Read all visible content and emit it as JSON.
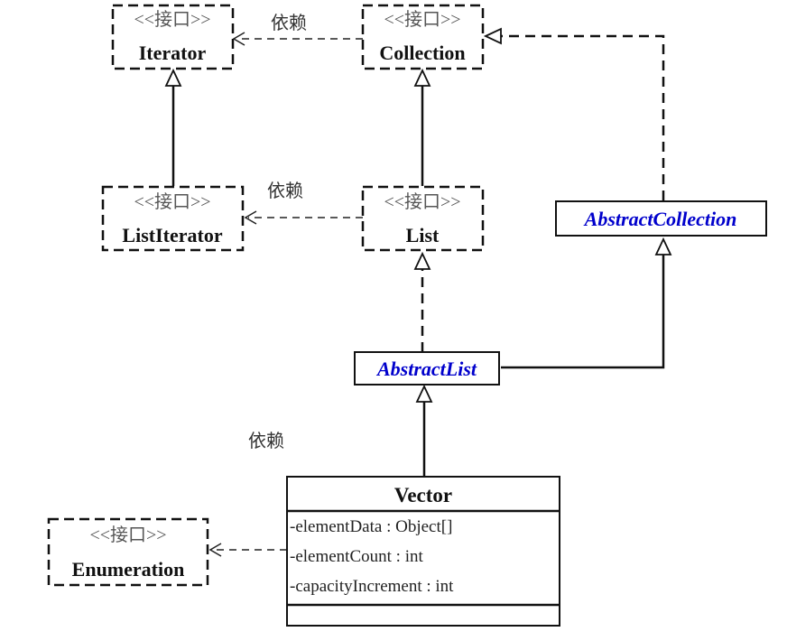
{
  "stereotype": "<<接口>>",
  "dependency_label": "依赖",
  "interfaces": {
    "iterator": "Iterator",
    "collection": "Collection",
    "list_iterator": "ListIterator",
    "list": "List",
    "enumeration": "Enumeration"
  },
  "abstract_classes": {
    "abstract_collection": "AbstractCollection",
    "abstract_list": "AbstractList"
  },
  "vector": {
    "name": "Vector",
    "attributes": [
      "-elementData : Object[]",
      "-elementCount : int",
      "-capacityIncrement : int"
    ]
  }
}
